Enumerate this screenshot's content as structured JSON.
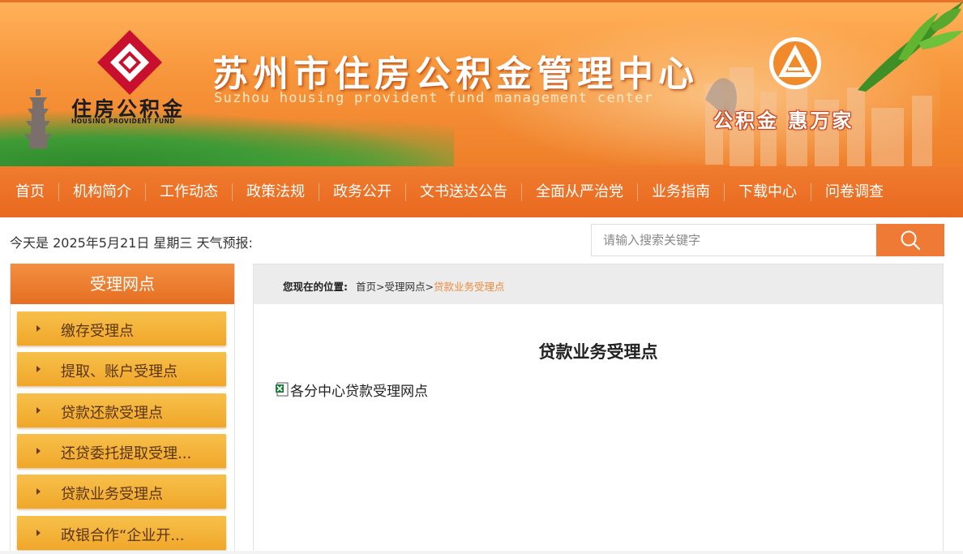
{
  "banner": {
    "logo_cn": "住房公积金",
    "logo_en": "HOUSING PROVIDENT FUND",
    "title": "苏州市住房公积金管理中心",
    "subtitle": "Suzhou housing provident fund management center",
    "slogan": "公积金 惠万家",
    "colors": {
      "primary": "#ef7a35",
      "logo_red": "#c8102e",
      "tab_gold": "#f2b033"
    }
  },
  "nav": {
    "items": [
      "首页",
      "机构简介",
      "工作动态",
      "政策法规",
      "政务公开",
      "文书送达公告",
      "全面从严治党",
      "业务指南",
      "下载中心",
      "问卷调查"
    ]
  },
  "info": {
    "date_text": "今天是 2025年5月21日  星期三  天气预报:"
  },
  "search": {
    "placeholder": "请输入搜索关键字",
    "icon": "search-icon"
  },
  "sidebar": {
    "title": "受理网点",
    "items": [
      {
        "label": "缴存受理点"
      },
      {
        "label": "提取、账户受理点"
      },
      {
        "label": "贷款还款受理点"
      },
      {
        "label": "还贷委托提取受理..."
      },
      {
        "label": "贷款业务受理点"
      },
      {
        "label": "政银合作“企业开..."
      }
    ]
  },
  "breadcrumb": {
    "prefix": "您现在的位置:",
    "path": "首页>受理网点>",
    "current": "贷款业务受理点"
  },
  "content": {
    "title": "贷款业务受理点",
    "attachment": "各分中心贷款受理网点",
    "attachment_icon": "excel-file-icon"
  }
}
